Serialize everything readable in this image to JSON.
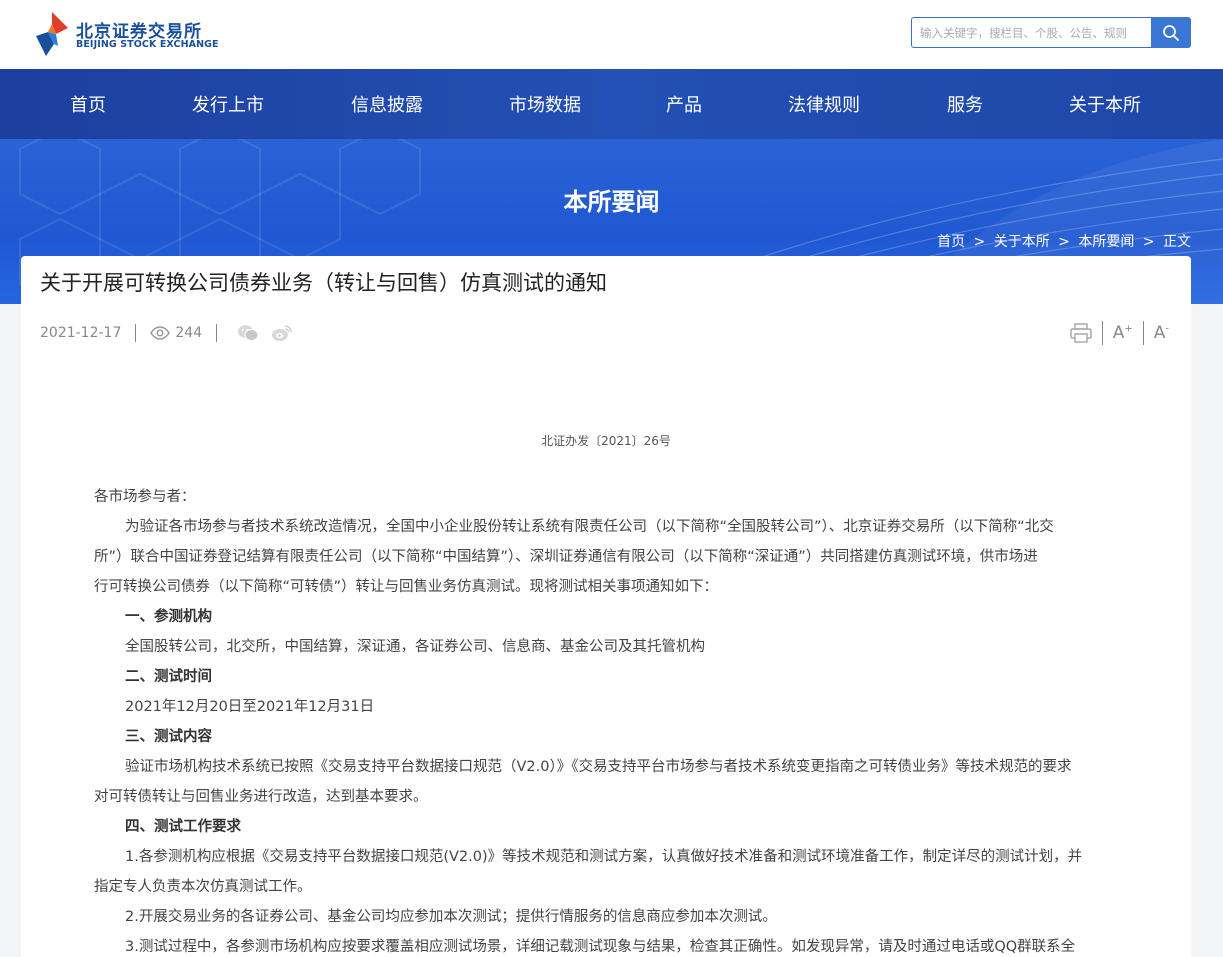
{
  "logo": {
    "name_cn": "北京证券交易所",
    "name_en": "BEIJING STOCK EXCHANGE"
  },
  "search": {
    "placeholder": "输入关键字，搜栏目、个股、公告、规则"
  },
  "nav": [
    "首页",
    "发行上市",
    "信息披露",
    "市场数据",
    "产品",
    "法律规则",
    "服务",
    "关于本所"
  ],
  "banner": {
    "title": "本所要闻"
  },
  "breadcrumb": {
    "items": [
      "首页",
      "关于本所",
      "本所要闻",
      "正文"
    ],
    "sep": ">"
  },
  "article": {
    "title": "关于开展可转换公司债券业务（转让与回售）仿真测试的通知",
    "date": "2021-12-17",
    "views": "244",
    "font_plus": "A",
    "font_minus": "A",
    "doc_number": "北证办发〔2021〕26号",
    "lines": [
      "各市场参与者：",
      "为验证各市场参与者技术系统改造情况，全国中小企业股份转让系统有限责任公司（以下简称“全国股转公司”）、北京证券交易所（以下简称“北交",
      "所”）联合中国证券登记结算有限责任公司（以下简称“中国结算”）、深圳证券通信有限公司（以下简称“深证通”）共同搭建仿真测试环境，供市场进",
      "行可转换公司债券（以下简称“可转债”）转让与回售业务仿真测试。现将测试相关事项通知如下：",
      "一、参测机构",
      "全国股转公司，北交所，中国结算，深证通，各证券公司、信息商、基金公司及其托管机构",
      "二、测试时间",
      "2021年12月20日至2021年12月31日",
      "三、测试内容",
      "验证市场机构技术系统已按照《交易支持平台数据接口规范（V2.0）》《交易支持平台市场参与者技术系统变更指南之可转债业务》等技术规范的要求",
      "对可转债转让与回售业务进行改造，达到基本要求。",
      "四、测试工作要求",
      "1.各参测机构应根据《交易支持平台数据接口规范(V2.0)》等技术规范和测试方案，认真做好技术准备和测试环境准备工作，制定详尽的测试计划，并",
      "指定专人负责本次仿真测试工作。",
      "2.开展交易业务的各证券公司、基金公司均应参加本次测试；提供行情服务的信息商应参加本次测试。",
      "3.测试过程中，各参测市场机构应按要求覆盖相应测试场景，详细记载测试现象与结果，检查其正确性。如发现异常，请及时通过电话或QQ群联系全"
    ]
  },
  "colors": {
    "brand_blue": "#1a4f9c",
    "nav_blue": "#2350b4",
    "accent": "#3a77d4"
  }
}
